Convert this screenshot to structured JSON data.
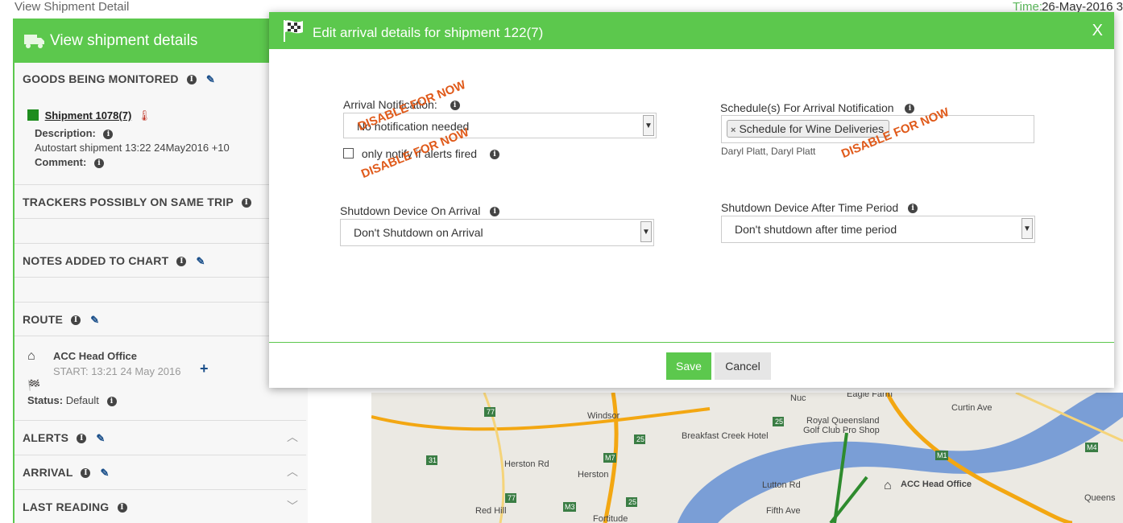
{
  "page": {
    "title": "View Shipment Detail",
    "time_label": "Time:",
    "time_value": "26-May-2016 3"
  },
  "sidebar": {
    "header": "View shipment details",
    "goods": {
      "title": "GOODS BEING MONITORED",
      "shipment_link": "Shipment 1078(7)",
      "description_label": "Description:",
      "description_value": "Autostart shipment 13:22 24May2016 +10",
      "comment_label": "Comment:"
    },
    "trackers_title": "TRACKERS POSSIBLY ON SAME TRIP",
    "notes_title": "NOTES ADDED TO CHART",
    "route": {
      "title": "ROUTE",
      "location": "ACC Head Office",
      "start": "START: 13:21 24 May 2016",
      "status_label": "Status:",
      "status_value": "Default"
    },
    "alerts_title": "ALERTS",
    "arrival_title": "ARRIVAL",
    "last_reading_title": "LAST READING"
  },
  "map": {
    "labels": [
      "Windsor",
      "Breakfast Creek Hotel",
      "Royal Queensland Golf Club Pro Shop",
      "Eagle Farm",
      "Curtin Ave",
      "ACC Head Office",
      "Herston Rd",
      "Herston",
      "Red Hill",
      "Fortitude",
      "Lutton Rd",
      "Fifth Ave",
      "Queens",
      "Nuc"
    ],
    "route_badges": [
      "77",
      "25",
      "31",
      "M7",
      "25",
      "M1",
      "M3",
      "77",
      "25",
      "M4"
    ],
    "route_colors": {
      "primary": "#f3a712",
      "river": "#2e5d9e",
      "track": "#2e8b2e"
    }
  },
  "modal": {
    "title": "Edit arrival details for shipment 122(7)",
    "close_label": "X",
    "arrival_notification": {
      "label": "Arrival Notification:",
      "selected": "No notification needed",
      "checkbox_label": "only notify if alerts fired",
      "stamp": "DISABLE FOR NOW"
    },
    "schedules": {
      "label": "Schedule(s) For Arrival Notification",
      "tag": "Schedule for Wine Deliveries",
      "people": "Daryl Platt, Daryl Platt",
      "stamp": "DISABLE FOR NOW"
    },
    "shutdown_on_arrival": {
      "label": "Shutdown Device On Arrival",
      "selected": "Don't Shutdown on Arrival"
    },
    "shutdown_after": {
      "label": "Shutdown Device After Time Period",
      "selected": "Don't shutdown after time period"
    },
    "save_label": "Save",
    "cancel_label": "Cancel"
  },
  "colors": {
    "accent_green": "#5cc84d",
    "stamp_orange": "#e05a1a",
    "link_blue": "#1a4f8a"
  }
}
